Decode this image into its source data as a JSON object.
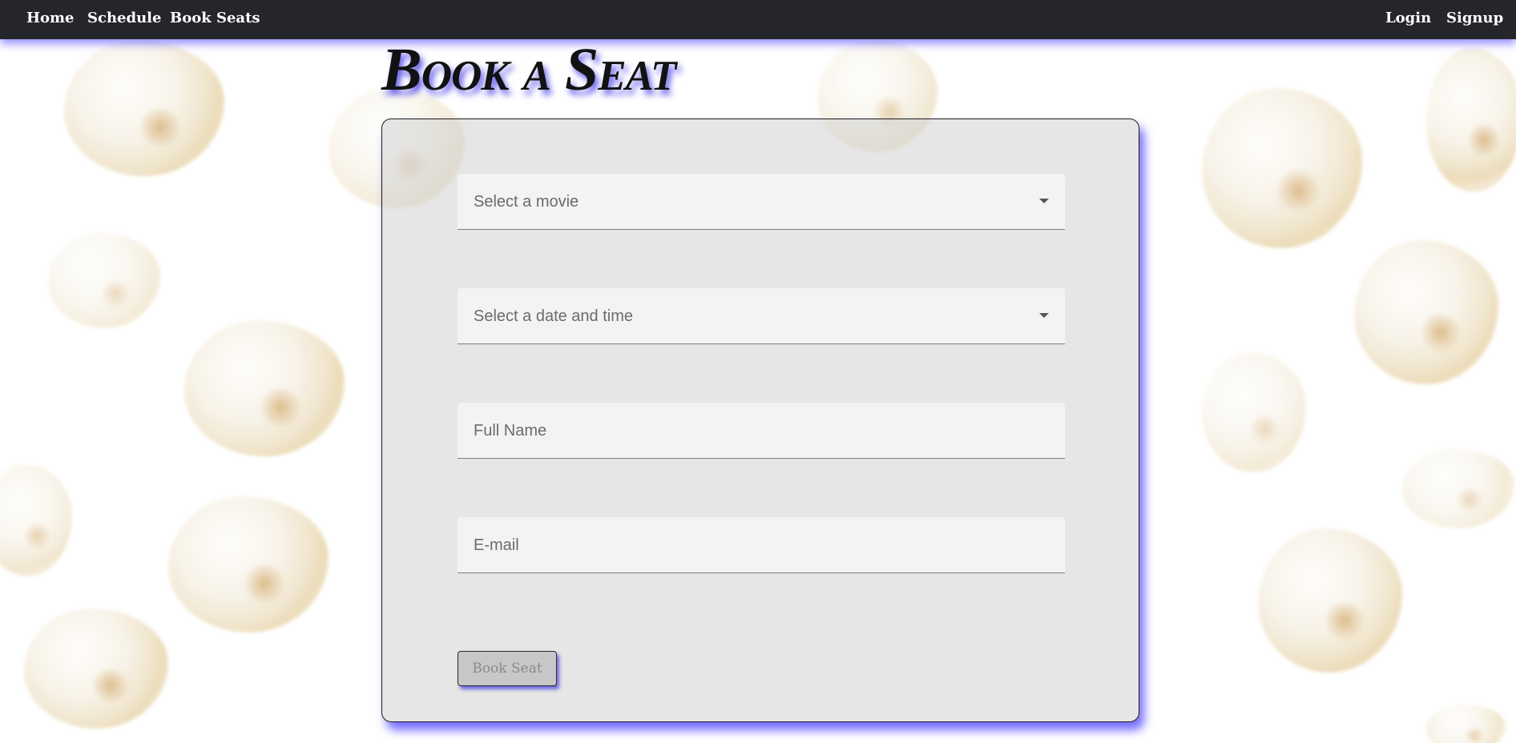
{
  "nav": {
    "left": [
      "Home",
      "Schedule",
      "Book Seats"
    ],
    "right": [
      "Login",
      "Signup"
    ]
  },
  "page": {
    "title": "Book a Seat"
  },
  "form": {
    "movie_placeholder": "Select a movie",
    "datetime_placeholder": "Select a date and time",
    "name_placeholder": "Full Name",
    "email_placeholder": "E-mail",
    "submit_label": "Book Seat"
  },
  "colors": {
    "navbar": "#25262b",
    "accent_shadow": "#4638ff",
    "card_bg": "#e2e2e2",
    "field_bg": "#f3f3f3"
  },
  "icons": {
    "select_arrow": "chevron-down-icon"
  }
}
